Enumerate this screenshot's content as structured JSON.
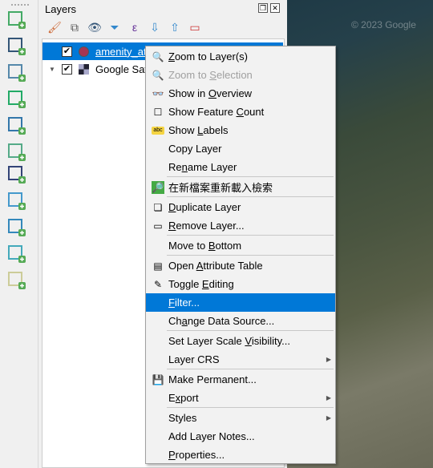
{
  "panel": {
    "title": "Layers",
    "float_icon": "float-icon",
    "close_icon": "close-icon",
    "tools": [
      "style-brush-icon",
      "add-group-icon",
      "visibility-eye-icon",
      "filter-legend-icon",
      "expression-filter-icon",
      "expand-all-icon",
      "collapse-all-icon",
      "remove-layer-icon"
    ]
  },
  "layers": [
    {
      "name": "amenity_at...",
      "checked": true,
      "selected": true,
      "icon": "point-symbol-icon",
      "symbol_color": "#a63552"
    },
    {
      "name": "Google Sat",
      "checked": true,
      "selected": false,
      "icon": "raster-icon"
    }
  ],
  "map": {
    "attribution": "© 2023 Google"
  },
  "left_toolbar": [
    "add-vector-icon",
    "add-raster-icon",
    "add-mesh-icon",
    "add-delimited-text-icon",
    "add-gps-icon",
    "add-virtual-layer-icon",
    "add-postgis-icon",
    "add-wms-icon",
    "add-wfs-icon",
    "add-wcs-icon",
    "add-xyz-icon"
  ],
  "menu": [
    {
      "label": "Zoom to Layer(s)",
      "u": 0,
      "icon": "zoom-layer-icon"
    },
    {
      "label": "Zoom to Selection",
      "u": 8,
      "icon": "zoom-selection-icon",
      "disabled": true
    },
    {
      "label": "Show in Overview",
      "u": 8,
      "icon": "overview-glasses-icon"
    },
    {
      "label": "Show Feature Count",
      "u": 13,
      "icon": "checkbox-icon"
    },
    {
      "label": "Show Labels",
      "u": 5,
      "icon": "labels-icon"
    },
    {
      "label": "Copy Layer"
    },
    {
      "label": "Rename Layer",
      "u": 2
    },
    {
      "sep": true
    },
    {
      "label": "在新檔案重新載入檢索",
      "icon": "reload-search-icon"
    },
    {
      "sep": true
    },
    {
      "label": "Duplicate Layer",
      "u": 0,
      "icon": "duplicate-layer-icon"
    },
    {
      "label": "Remove Layer...",
      "u": 0,
      "icon": "remove-layer-icon"
    },
    {
      "sep": true
    },
    {
      "label": "Move to Bottom",
      "u": 8
    },
    {
      "sep": true
    },
    {
      "label": "Open Attribute Table",
      "u": 5,
      "icon": "attribute-table-icon"
    },
    {
      "label": "Toggle Editing",
      "u": 7,
      "icon": "pencil-icon"
    },
    {
      "label": "Filter...",
      "u": 0,
      "highlighted": true
    },
    {
      "label": "Change Data Source...",
      "u": 2
    },
    {
      "sep": true
    },
    {
      "label": "Set Layer Scale Visibility...",
      "u": 16
    },
    {
      "label": "Layer CRS",
      "submenu": true
    },
    {
      "sep": true
    },
    {
      "label": "Make Permanent...",
      "icon": "save-icon"
    },
    {
      "label": "Export",
      "u": 1,
      "submenu": true
    },
    {
      "sep": true
    },
    {
      "label": "Styles",
      "submenu": true
    },
    {
      "label": "Add Layer Notes..."
    },
    {
      "label": "Properties...",
      "u": 0
    }
  ],
  "colors": {
    "highlight": "#0078d7",
    "menu_bg": "#f2f2f2"
  }
}
